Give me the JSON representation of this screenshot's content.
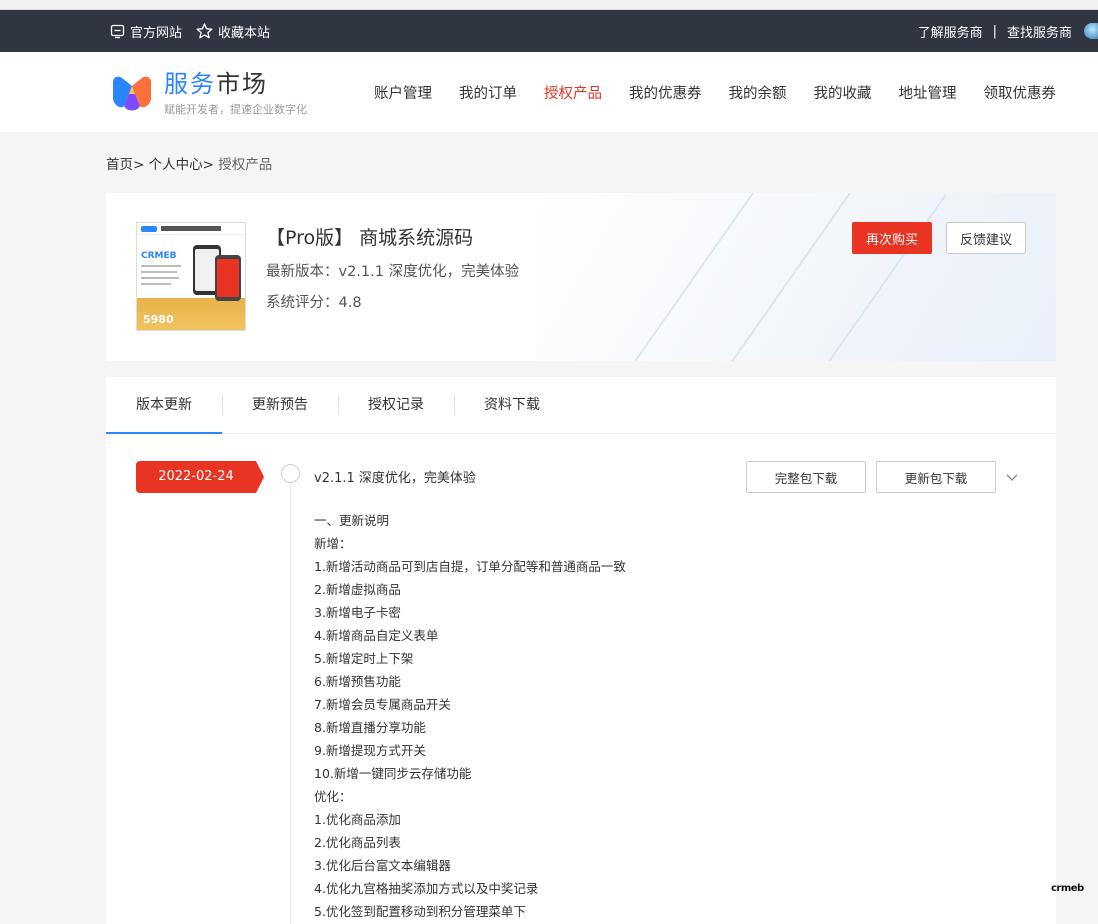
{
  "topbar": {
    "official_site": "官方网站",
    "bookmark": "收藏本站",
    "learn_provider": "了解服务商",
    "separator": "|",
    "find_provider": "查找服务商"
  },
  "header": {
    "brand_part1": "服务",
    "brand_part2": "市场",
    "slogan": "赋能开发者，提速企业数字化",
    "nav": [
      {
        "label": "账户管理",
        "active": false
      },
      {
        "label": "我的订单",
        "active": false
      },
      {
        "label": "授权产品",
        "active": true
      },
      {
        "label": "我的优惠券",
        "active": false
      },
      {
        "label": "我的余额",
        "active": false
      },
      {
        "label": "我的收藏",
        "active": false
      },
      {
        "label": "地址管理",
        "active": false
      },
      {
        "label": "领取优惠券",
        "active": false
      }
    ]
  },
  "breadcrumb": {
    "home": "首页>",
    "center": "个人中心>",
    "current": "授权产品"
  },
  "product": {
    "thumb_brand": "CRMEB",
    "thumb_price": "5980",
    "title": "【Pro版】 商城系统源码",
    "version": "最新版本：v2.1.1 深度优化，完美体验",
    "score": "系统评分：4.8",
    "buy_again": "再次购买",
    "feedback": "反馈建议"
  },
  "tabs": [
    "版本更新",
    "更新预告",
    "授权记录",
    "资料下载"
  ],
  "release": {
    "date": "2022-02-24",
    "title": "v2.1.1 深度优化，完美体验",
    "full_download": "完整包下载",
    "update_download": "更新包下载",
    "notes": [
      "一、更新说明",
      "新增：",
      "1.新增活动商品可到店自提，订单分配等和普通商品一致",
      "2.新增虚拟商品",
      "3.新增电子卡密",
      "4.新增商品自定义表单",
      "5.新增定时上下架",
      "6.新增预售功能",
      "7.新增会员专属商品开关",
      "8.新增直播分享功能",
      "9.新增提现方式开关",
      "10.新增一键同步云存储功能",
      "优化：",
      "1.优化商品添加",
      "2.优化商品列表",
      "3.优化后台富文本编辑器",
      "4.优化九宫格抽奖添加方式以及中奖记录",
      "5.优化签到配置移动到积分管理菜单下"
    ]
  },
  "watermark": "crmeb",
  "colors": {
    "accent_red": "#e93323",
    "brand_blue": "#2a86ff",
    "topbar_bg": "#2f3541"
  }
}
